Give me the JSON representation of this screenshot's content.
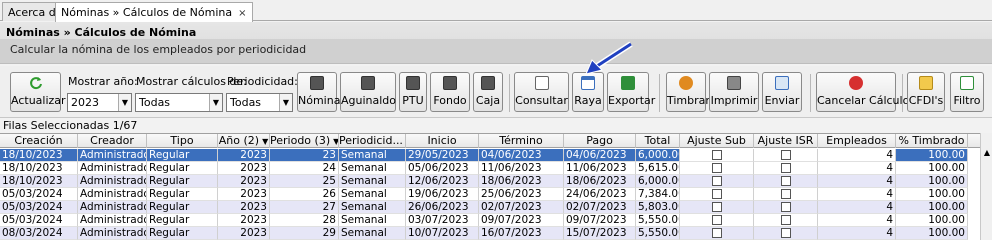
{
  "tabs": [
    {
      "label": "Acerca de"
    },
    {
      "label": "Nóminas » Cálculos de Nómina",
      "close": "×"
    }
  ],
  "header": {
    "title": "Nóminas » Cálculos de Nómina",
    "subtitle": "Calcular la nómina de los empleados por periodicidad"
  },
  "toolbar": {
    "actualizar": "Actualizar",
    "year_label": "Mostrar año:",
    "year_value": "2023",
    "calc_label": "Mostrar cálculos de:",
    "calc_value": "Todas",
    "period_label": "Periodicidad:",
    "period_value": "Todas",
    "nomina": "Nómina",
    "aguinaldo": "Aguinaldo",
    "ptu": "PTU",
    "fondo": "Fondo",
    "caja": "Caja",
    "consultar": "Consultar",
    "raya": "Raya",
    "exportar": "Exportar",
    "timbrar": "Timbrar",
    "imprimir": "Imprimir",
    "enviar": "Enviar",
    "cancelar": "Cancelar Cálculo",
    "cfdis": "CFDI's",
    "filtro": "Filtro"
  },
  "status": "Filas Seleccionadas  1/67",
  "grid": {
    "columns": [
      "Creación",
      "Creador",
      "Tipo",
      "Año (2)",
      "Periodo (3)",
      "Periodicid...",
      "Inicio",
      "Término",
      "Pago",
      "Total",
      "Ajuste Sub",
      "Ajuste ISR",
      "Empleados",
      "% Timbrado"
    ],
    "rows": [
      [
        "18/10/2023",
        "Administrador",
        "Regular",
        "2023",
        "23",
        "Semanal",
        "29/05/2023",
        "04/06/2023",
        "04/06/2023",
        "6,000.00",
        "",
        "",
        "4",
        "100.00"
      ],
      [
        "18/10/2023",
        "Administrador",
        "Regular",
        "2023",
        "24",
        "Semanal",
        "05/06/2023",
        "11/06/2023",
        "11/06/2023",
        "5,615.00",
        "",
        "",
        "4",
        "100.00"
      ],
      [
        "18/10/2023",
        "Administrador",
        "Regular",
        "2023",
        "25",
        "Semanal",
        "12/06/2023",
        "18/06/2023",
        "18/06/2023",
        "6,000.00",
        "",
        "",
        "4",
        "100.00"
      ],
      [
        "05/03/2024",
        "Administrador",
        "Regular",
        "2023",
        "26",
        "Semanal",
        "19/06/2023",
        "25/06/2023",
        "24/06/2023",
        "7,384.00",
        "",
        "",
        "4",
        "100.00"
      ],
      [
        "05/03/2024",
        "Administrador",
        "Regular",
        "2023",
        "27",
        "Semanal",
        "26/06/2023",
        "02/07/2023",
        "02/07/2023",
        "5,803.00",
        "",
        "",
        "4",
        "100.00"
      ],
      [
        "05/03/2024",
        "Administrador",
        "Regular",
        "2023",
        "28",
        "Semanal",
        "03/07/2023",
        "09/07/2023",
        "09/07/2023",
        "5,550.00",
        "",
        "",
        "4",
        "100.00"
      ],
      [
        "08/03/2024",
        "Administrador",
        "Regular",
        "2023",
        "29",
        "Semanal",
        "10/07/2023",
        "16/07/2023",
        "15/07/2023",
        "5,550.00",
        "",
        "",
        "4",
        "100.00"
      ]
    ]
  },
  "colors": {
    "selection": "#3b6fbd",
    "alt_row": "#e6e6f7"
  }
}
